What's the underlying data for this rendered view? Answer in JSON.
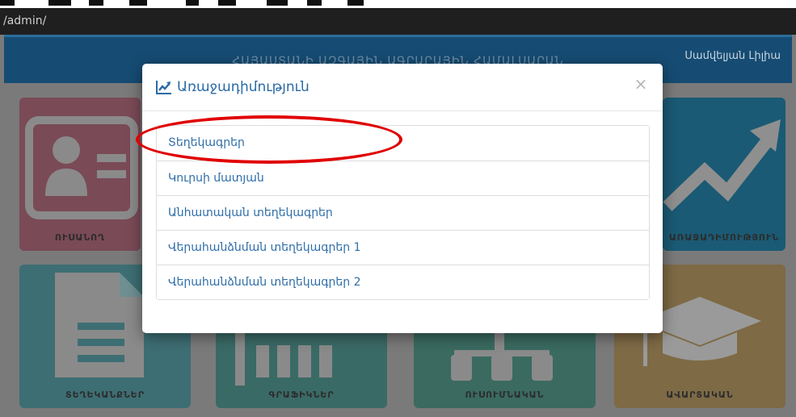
{
  "browser": {
    "url": "/admin/"
  },
  "banner": {
    "heading": "ՀԱՅԱՍՏԱՆԻ ԱԶԳԱՅԻՆ ԱԳՐԱՐԱՅԻՆ ՀԱՄԱԼՍԱՐԱՆ",
    "user_name": "Սամվելյան Լիլիա"
  },
  "tiles": [
    {
      "label": "ՈՒՍԱՆՈՂ",
      "color": "#7a4a57"
    },
    {
      "label": "ԱՌԱՋԱԴԻՄՈՒԹՅՈՒՆ",
      "color": "#1a5a74"
    },
    {
      "label": "ՏԵՂԵԿԱՆՔՆԵՐ",
      "color": "#3d6e73"
    },
    {
      "label": "ԳՐԱՖԻԿՆԵՐ",
      "color": "#3a6a66"
    },
    {
      "label": "ՈՒՍՈՒՄՆԱԿԱՆ",
      "color": "#3a6a60"
    },
    {
      "label": "ԱՎԱՐՏԱԿԱՆ",
      "color": "#7e6a45"
    }
  ],
  "modal": {
    "title": "Առաջադիմություն",
    "title_icon": "line-chart-icon",
    "close_label": "×",
    "items": [
      {
        "label": "Տեղեկագրեր"
      },
      {
        "label": "Կուրսի մատյան"
      },
      {
        "label": "Անհատական տեղեկագրեր"
      },
      {
        "label": "Վերահանձնման տեղեկագրեր 1"
      },
      {
        "label": "Վերահանձնման տեղեկագրեր 2"
      }
    ]
  },
  "colors": {
    "accent_link": "#2f6ea8",
    "highlight": "#e00000",
    "banner": "#164c73"
  }
}
